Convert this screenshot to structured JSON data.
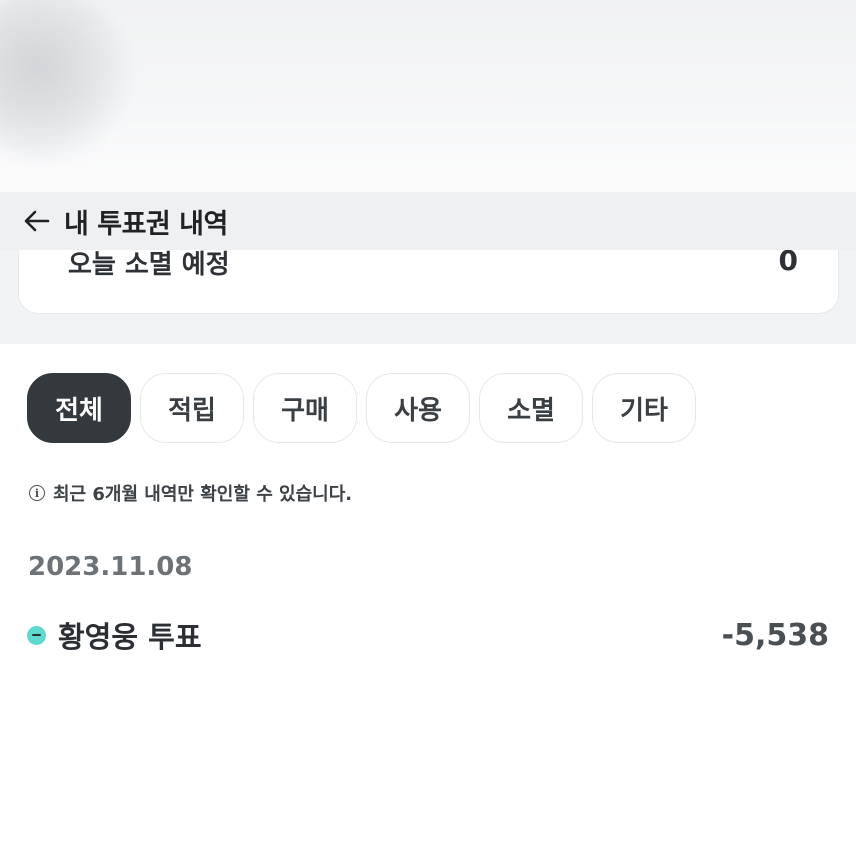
{
  "header": {
    "title": "내 투표권 내역",
    "back_icon": "arrow-left-icon"
  },
  "summary": {
    "label": "오늘 소멸 예정",
    "value": "0"
  },
  "filters": {
    "items": [
      {
        "label": "전체",
        "active": true
      },
      {
        "label": "적립",
        "active": false
      },
      {
        "label": "구매",
        "active": false
      },
      {
        "label": "사용",
        "active": false
      },
      {
        "label": "소멸",
        "active": false
      },
      {
        "label": "기타",
        "active": false
      }
    ]
  },
  "notice": {
    "icon": "info-icon",
    "text": "최근 6개월 내역만 확인할 수 있습니다."
  },
  "history": {
    "groups": [
      {
        "date": "2023.11.08",
        "items": [
          {
            "title": "황영웅 투표",
            "amount": "-5,538",
            "type_icon": "minus-icon",
            "accent": "#5fd9cf"
          }
        ]
      }
    ]
  }
}
